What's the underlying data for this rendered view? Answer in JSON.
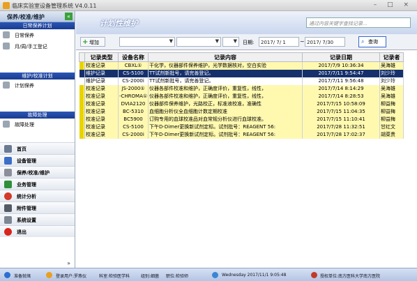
{
  "window": {
    "title": "临床实验室设备管理系统 V4.0.11"
  },
  "sidebar": {
    "header": "保养/校准/维护",
    "groups": [
      {
        "title": "日常保养计划",
        "items": [
          "日常保养",
          "月/周/手工登记"
        ]
      },
      {
        "title": "维护/校准计划",
        "items": [
          "计划保养"
        ]
      },
      {
        "title": "故障处理",
        "items": [
          "故障处理"
        ]
      }
    ],
    "modules": [
      "首页",
      "设备管理",
      "保养/校准/维护",
      "业务管理",
      "统计分析",
      "附件管理",
      "系统设置",
      "退出"
    ]
  },
  "main": {
    "title": "计划性维护",
    "search_placeholder": "通过内容关键字查找记录...",
    "add_label": "增加",
    "date_label": "日期:",
    "date_from": "2017/ 7/ 1",
    "date_to": "2017/ 7/30",
    "query_label": "查询"
  },
  "table": {
    "headers": [
      "记录类型",
      "设备名称",
      "记录内容",
      "记录日期",
      "记录者"
    ],
    "rows": [
      {
        "type": "校准记录",
        "device": "CBXL①",
        "content": "干化学，仪器部件保养维护，光学数据核对，空白实验",
        "date": "2017/7/9 10:36:34",
        "user": "吴海雄",
        "style": "yellow"
      },
      {
        "type": "维护记录",
        "device": "CS-5100",
        "content": "TT试剂新批号，请完善登记。",
        "date": "2017/7/11 9:54:47",
        "user": "刘少玲",
        "style": "sel"
      },
      {
        "type": "维护记录",
        "device": "CS-2000i",
        "content": "TT试剂新批号，请完善登记。",
        "date": "2017/7/11 9:56:48",
        "user": "刘少玲",
        "style": "white"
      },
      {
        "type": "校准记录",
        "device": "JS-2000①",
        "content": "仪器各部件校准和维护，正确度评价，重复性，线性，",
        "date": "2017/7/14 8:14:29",
        "user": "吴海雄",
        "style": "yellow"
      },
      {
        "type": "校准记录",
        "device": "-CHROMA①",
        "content": "仪器各部件校准和维护，正确度评价，重复性，线性，",
        "date": "2017/7/14 8:28:53",
        "user": "吴海雄",
        "style": "yellow"
      },
      {
        "type": "校准记录",
        "device": "DVIA2120",
        "content": "仪器部件保养维护，光路校正，标准液校准，准确性",
        "date": "2017/7/15 10:58:09",
        "user": "柳益梅",
        "style": "yellow"
      },
      {
        "type": "校准记录",
        "device": "BC-5310",
        "content": "血细胞分析仪全血细胞计数定期校准",
        "date": "2017/7/15 11:04:35",
        "user": "柳益梅",
        "style": "yellow"
      },
      {
        "type": "校准记录",
        "device": "BC5900",
        "content": "订购专用的血球校准品对血常规分析仪进行血球校准。",
        "date": "2017/7/15 11:10:41",
        "user": "柳益梅",
        "style": "yellow"
      },
      {
        "type": "校准记录",
        "device": "CS-5100",
        "content": "下午D-Dimer更换新试剂定标。试剂批号：REAGENT 56:",
        "date": "2017/7/28 11:32:51",
        "user": "甘红文",
        "style": "yellow"
      },
      {
        "type": "校准记录",
        "device": "CS-2000i",
        "content": "下午D-Dimer更换新试剂定标。试剂批号：REAGENT 56:",
        "date": "2017/7/28 17:02:37",
        "user": "胡菜贵",
        "style": "yellow"
      }
    ]
  },
  "status": {
    "ready": "准备就绪",
    "user": "登录用户:罗燕仪",
    "dept": "科室:检验医学科",
    "group": "组别:细菌",
    "role": "职位:检验师",
    "datetime": "Wednesday 2017/11/1 9:05:48",
    "license": "授权单位:南方医科大学南方医院"
  },
  "colors": {
    "selected_row": "#16306c",
    "yellow_row": "#fff9b0",
    "group_header": "#1a3c8f"
  }
}
